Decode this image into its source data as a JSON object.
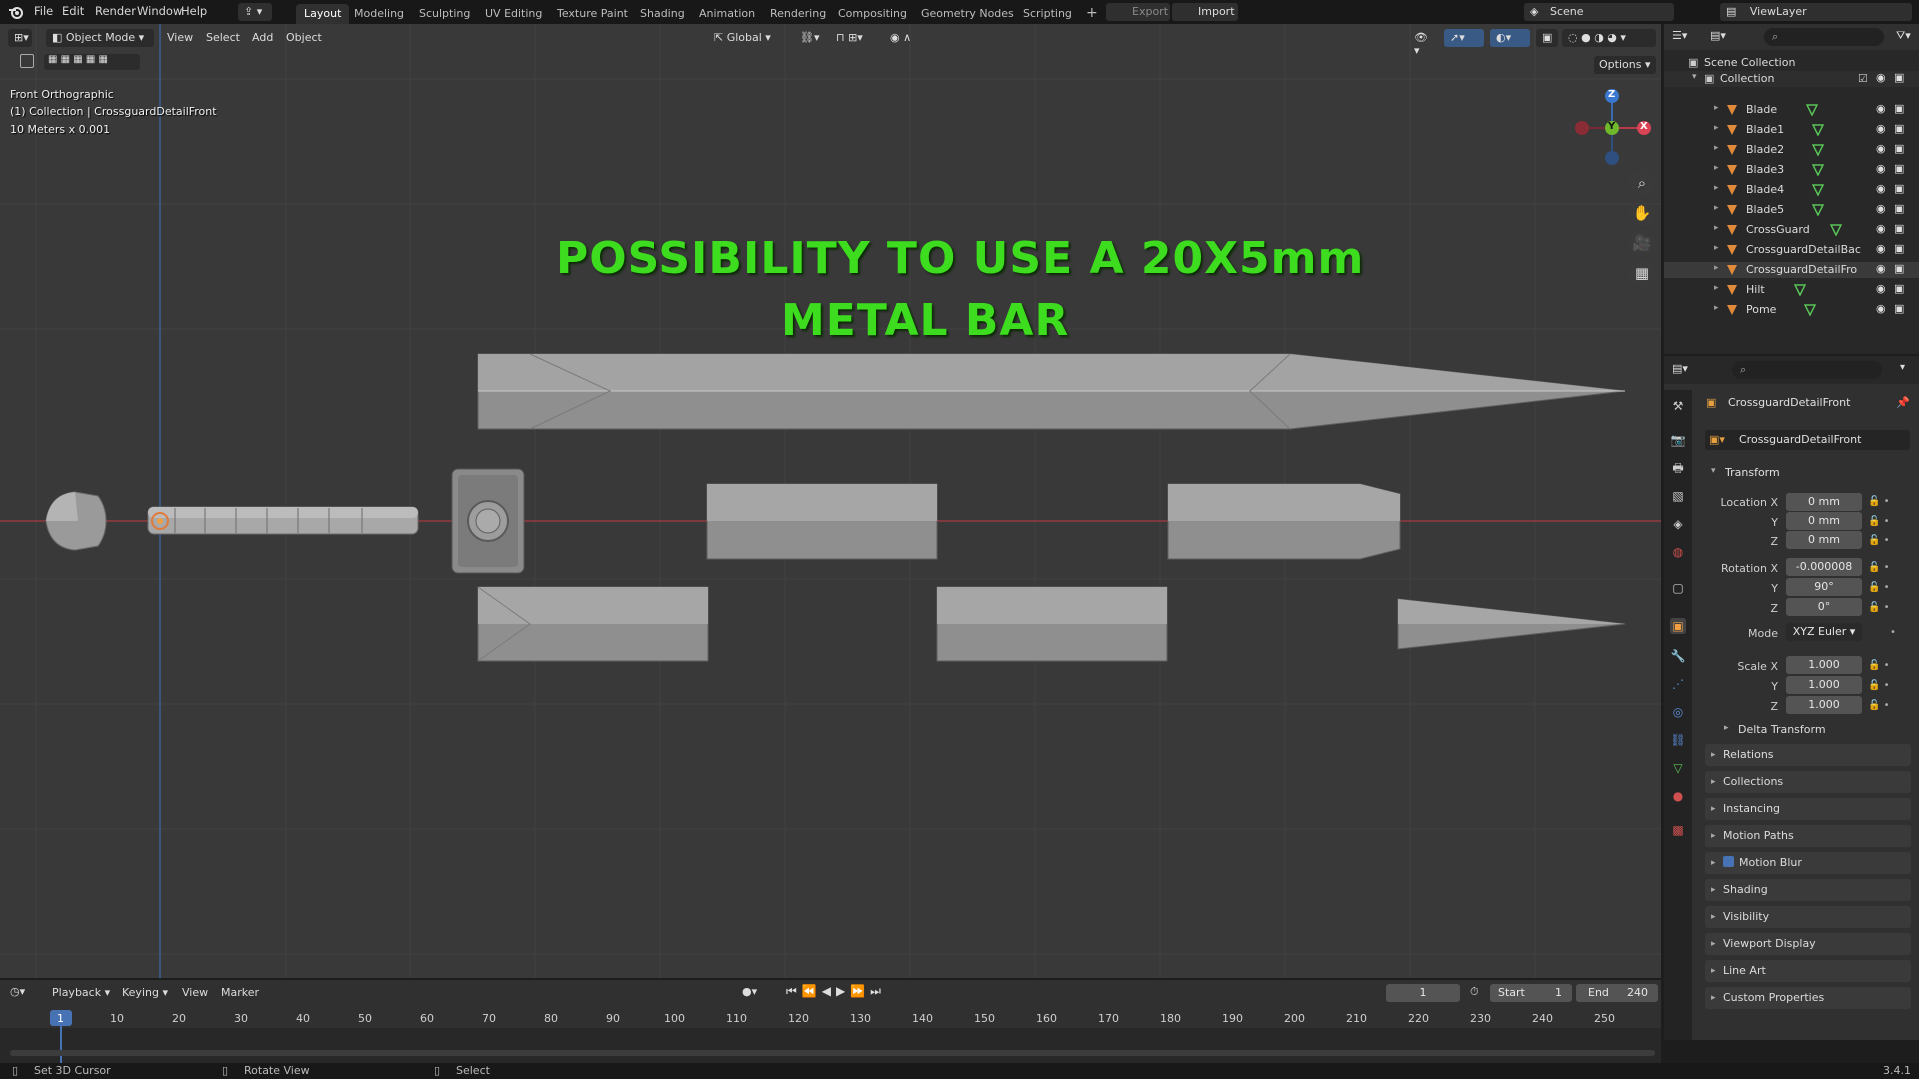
{
  "menu": {
    "items": [
      "File",
      "Edit",
      "Render",
      "Window",
      "Help"
    ]
  },
  "workspaces": [
    "Layout",
    "Modeling",
    "Sculpting",
    "UV Editing",
    "Texture Paint",
    "Shading",
    "Animation",
    "Rendering",
    "Compositing",
    "Geometry Nodes",
    "Scripting"
  ],
  "topbar": {
    "export_label": "Export",
    "import_label": "Import",
    "scene": "Scene",
    "view_layer": "ViewLayer"
  },
  "viewport_header": {
    "mode": "Object Mode",
    "view": "View",
    "select": "Select",
    "add": "Add",
    "object": "Object",
    "orientation": "Global",
    "options": "Options"
  },
  "viewport_overlay": {
    "view_name": "Front Orthographic",
    "collection_info": "(1) Collection | CrossguardDetailFront",
    "scale_info": "10 Meters x 0.001"
  },
  "annotation": {
    "line1": "POSSIBILITY TO USE A 20X5mm",
    "line2": "METAL  BAR"
  },
  "gizmo": {
    "z": "Z",
    "y": "Y",
    "x": "X"
  },
  "outliner": {
    "scene_collection": "Scene Collection",
    "collection": "Collection",
    "objects": [
      "Blade",
      "Blade1",
      "Blade2",
      "Blade3",
      "Blade4",
      "Blade5",
      "CrossGuard",
      "CrossguardDetailBac",
      "CrossguardDetailFro",
      "Hilt",
      "Pome"
    ]
  },
  "properties": {
    "object_name": "CrossguardDetailFront",
    "data_name": "CrossguardDetailFront",
    "transform_label": "Transform",
    "location_label": "Location X",
    "y_label": "Y",
    "z_label": "Z",
    "location": [
      "0 mm",
      "0 mm",
      "0 mm"
    ],
    "rotation_label": "Rotation X",
    "rotation": [
      "-0.000008",
      "90°",
      "0°"
    ],
    "mode_label": "Mode",
    "mode_value": "XYZ Euler",
    "scale_label": "Scale X",
    "scale": [
      "1.000",
      "1.000",
      "1.000"
    ],
    "delta_transform": "Delta Transform",
    "panels": [
      "Relations",
      "Collections",
      "Instancing",
      "Motion Paths",
      "Motion Blur",
      "Shading",
      "Visibility",
      "Viewport Display",
      "Line Art",
      "Custom Properties"
    ]
  },
  "timeline": {
    "playback": "Playback",
    "keying": "Keying",
    "view": "View",
    "marker": "Marker",
    "current_frame": "1",
    "start_label": "Start",
    "start": "1",
    "end_label": "End",
    "end": "240",
    "ticks": [
      "1",
      "10",
      "20",
      "30",
      "40",
      "50",
      "60",
      "70",
      "80",
      "90",
      "100",
      "110",
      "120",
      "130",
      "140",
      "150",
      "160",
      "170",
      "180",
      "190",
      "200",
      "210",
      "220",
      "230",
      "240",
      "250"
    ]
  },
  "statusbar": {
    "set_cursor": "Set 3D Cursor",
    "rotate_view": "Rotate View",
    "select": "Select",
    "version": "3.4.1"
  }
}
